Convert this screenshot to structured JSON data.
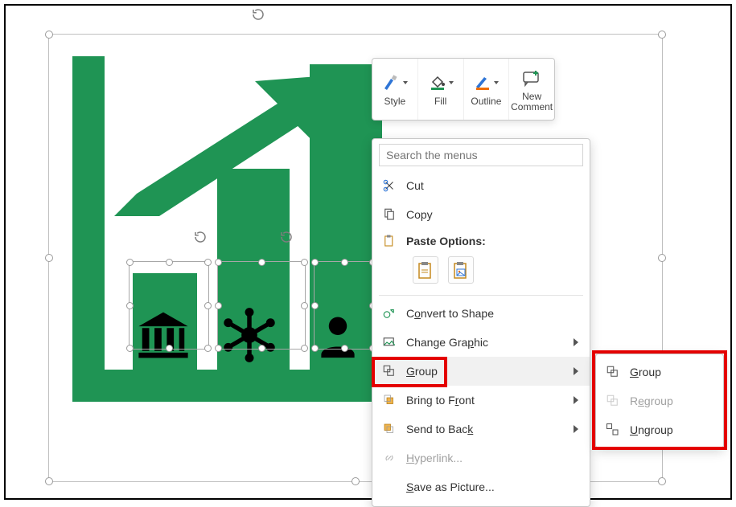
{
  "mini_toolbar": {
    "style": "Style",
    "fill": "Fill",
    "outline": "Outline",
    "new_comment": "New Comment"
  },
  "context_menu": {
    "search_placeholder": "Search the menus",
    "cut": "Cut",
    "copy": "Copy",
    "paste_options_label": "Paste Options:",
    "convert_to_shape": "Convert to Shape",
    "change_graphic": "Change Graphic",
    "group": "Group",
    "bring_to_front": "Bring to Front",
    "send_to_back": "Send to Back",
    "hyperlink": "Hyperlink...",
    "save_as_picture": "Save as Picture..."
  },
  "submenu": {
    "group": "Group",
    "regroup": "Regroup",
    "ungroup": "Ungroup"
  },
  "icons": {
    "bar_icon_1": "bank-icon",
    "bar_icon_2": "network-hub-icon",
    "bar_icon_3": "person-icon"
  },
  "colors": {
    "brand_green": "#1f9454",
    "highlight_red": "#e40000"
  }
}
